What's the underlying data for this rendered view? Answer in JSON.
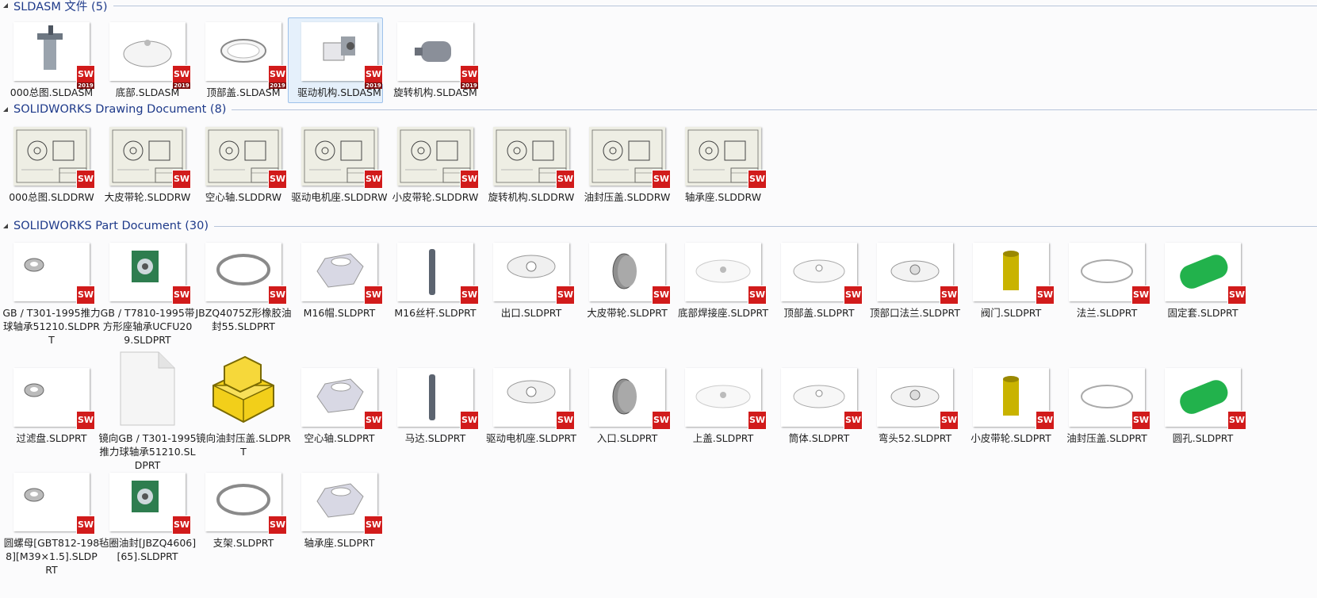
{
  "groups": [
    {
      "title": "SLDASM 文件 (5)",
      "items": [
        {
          "label": "000总图.SLDASM",
          "icon": "sw-assembly-icon",
          "version": "2019"
        },
        {
          "label": "底部.SLDASM",
          "icon": "sw-assembly-icon",
          "version": "2019"
        },
        {
          "label": "顶部盖.SLDASM",
          "icon": "sw-assembly-icon",
          "version": "2019"
        },
        {
          "label": "驱动机构.SLDASM",
          "icon": "sw-assembly-icon",
          "version": "2019",
          "selected": true
        },
        {
          "label": "旋转机构.SLDASM",
          "icon": "sw-assembly-icon",
          "version": "2019"
        }
      ]
    },
    {
      "title": "SOLIDWORKS Drawing Document (8)",
      "items": [
        {
          "label": "000总图.SLDDRW",
          "icon": "sw-drawing-icon"
        },
        {
          "label": "大皮带轮.SLDDRW",
          "icon": "sw-drawing-icon"
        },
        {
          "label": "空心轴.SLDDRW",
          "icon": "sw-drawing-icon"
        },
        {
          "label": "驱动电机座.SLDDRW",
          "icon": "sw-drawing-icon"
        },
        {
          "label": "小皮带轮.SLDDRW",
          "icon": "sw-drawing-icon"
        },
        {
          "label": "旋转机构.SLDDRW",
          "icon": "sw-drawing-icon"
        },
        {
          "label": "油封压盖.SLDDRW",
          "icon": "sw-drawing-icon"
        },
        {
          "label": "轴承座.SLDDRW",
          "icon": "sw-drawing-icon"
        }
      ]
    },
    {
      "title": "SOLIDWORKS Part Document (30)",
      "items": [
        {
          "label": "GB / T301-1995推力球轴承51210.SLDPRT",
          "icon": "sw-part-icon"
        },
        {
          "label": "GB / T7810-1995带方形座轴承UCFU209.SLDPRT",
          "icon": "sw-part-icon"
        },
        {
          "label": "JBZQ4075Z形橡胶油封55.SLDPRT",
          "icon": "sw-part-icon"
        },
        {
          "label": "M16帽.SLDPRT",
          "icon": "sw-part-icon"
        },
        {
          "label": "M16丝杆.SLDPRT",
          "icon": "sw-part-icon"
        },
        {
          "label": "出口.SLDPRT",
          "icon": "sw-part-icon"
        },
        {
          "label": "大皮带轮.SLDPRT",
          "icon": "sw-part-icon"
        },
        {
          "label": "底部焊接座.SLDPRT",
          "icon": "sw-part-icon"
        },
        {
          "label": "顶部盖.SLDPRT",
          "icon": "sw-part-icon"
        },
        {
          "label": "顶部口法兰.SLDPRT",
          "icon": "sw-part-icon"
        },
        {
          "label": "阀门.SLDPRT",
          "icon": "sw-part-icon"
        },
        {
          "label": "法兰.SLDPRT",
          "icon": "sw-part-icon"
        },
        {
          "label": "固定套.SLDPRT",
          "icon": "sw-part-icon"
        },
        {
          "label": "过滤盘.SLDPRT",
          "icon": "sw-part-icon"
        },
        {
          "label": "镜向GB / T301-1995推力球轴承51210.SLDPRT",
          "icon": "blank-file-icon"
        },
        {
          "label": "镜向油封压盖.SLDPRT",
          "icon": "generic-part-icon"
        },
        {
          "label": "空心轴.SLDPRT",
          "icon": "sw-part-icon"
        },
        {
          "label": "马达.SLDPRT",
          "icon": "sw-part-icon"
        },
        {
          "label": "驱动电机座.SLDPRT",
          "icon": "sw-part-icon"
        },
        {
          "label": "入口.SLDPRT",
          "icon": "sw-part-icon"
        },
        {
          "label": "上盖.SLDPRT",
          "icon": "sw-part-icon"
        },
        {
          "label": "筒体.SLDPRT",
          "icon": "sw-part-icon"
        },
        {
          "label": "弯头52.SLDPRT",
          "icon": "sw-part-icon"
        },
        {
          "label": "小皮带轮.SLDPRT",
          "icon": "sw-part-icon"
        },
        {
          "label": "油封压盖.SLDPRT",
          "icon": "sw-part-icon"
        },
        {
          "label": "圆孔.SLDPRT",
          "icon": "sw-part-icon"
        },
        {
          "label": "圆螺母[GBT812-1988][M39×1.5].SLDPRT",
          "icon": "sw-part-icon"
        },
        {
          "label": "毡圈油封[JBZQ4606][65].SLDPRT",
          "icon": "sw-part-icon"
        },
        {
          "label": "支架.SLDPRT",
          "icon": "sw-part-icon"
        },
        {
          "label": "轴承座.SLDPRT",
          "icon": "sw-part-icon"
        }
      ]
    }
  ],
  "badge_text": "SW",
  "colors": {
    "badge": "#d11b1b",
    "group_title": "#1e3a8a",
    "selection": "#e5f0fb"
  }
}
